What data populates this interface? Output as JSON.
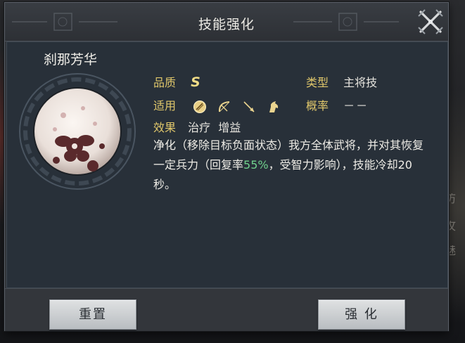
{
  "dialog": {
    "title": "技能强化",
    "close_icon": "crossed-swords-icon"
  },
  "skill": {
    "name": "刹那芳华",
    "quality_label": "品质",
    "quality_value": "S",
    "type_label": "类型",
    "type_value": "主将技",
    "applicable_label": "适用",
    "applicable_icons": [
      "shield-icon",
      "bow-icon",
      "spear-icon",
      "horse-icon"
    ],
    "chance_label": "概率",
    "chance_value": "－－",
    "effect_label": "效果",
    "effect_tags": [
      "治疗",
      "增益"
    ],
    "description_part1": "净化（移除目标负面状态）我方全体武将，并对其恢复一定兵力（回复率",
    "description_highlight": "55%",
    "description_part2": "，受智力影响），技能冷却20秒。",
    "highlight_color": "#6fd08c"
  },
  "buttons": {
    "reset_label": "重置",
    "enhance_label": "强 化"
  },
  "background": {
    "side_text": [
      "防",
      "攻",
      "魅"
    ]
  }
}
